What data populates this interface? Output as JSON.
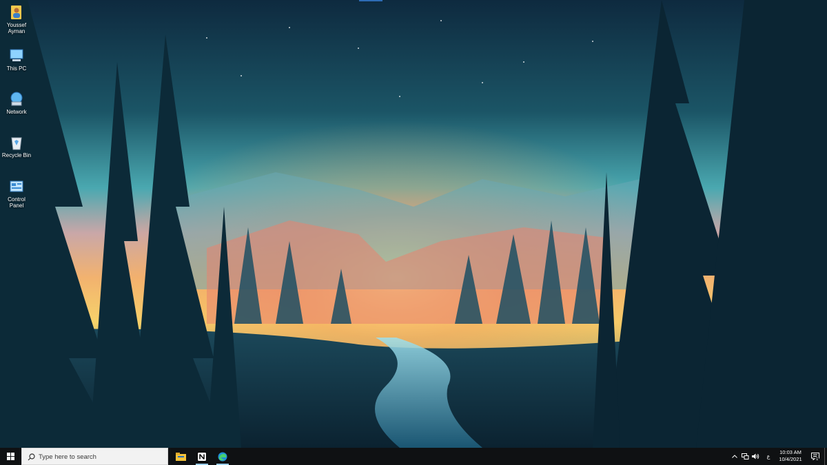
{
  "desktop": {
    "icons": [
      {
        "label": "Youssef Ayman",
        "icon": "user-folder-icon"
      },
      {
        "label": "This PC",
        "icon": "computer-icon"
      },
      {
        "label": "Network",
        "icon": "network-icon"
      },
      {
        "label": "Recycle Bin",
        "icon": "recycle-bin-icon"
      },
      {
        "label": "Control Panel",
        "icon": "control-panel-icon"
      }
    ]
  },
  "taskbar": {
    "search_placeholder": "Type here to search",
    "pinned": [
      "file-explorer-icon",
      "notion-icon",
      "edge-icon"
    ],
    "tray": {
      "language": "ع",
      "time": "10:03 AM",
      "date": "10/4/2021",
      "notification_count": "1"
    }
  },
  "colors": {
    "taskbar": "#0f1113",
    "search_box": "#f2f2f2",
    "accent": "#2d6cb5"
  }
}
